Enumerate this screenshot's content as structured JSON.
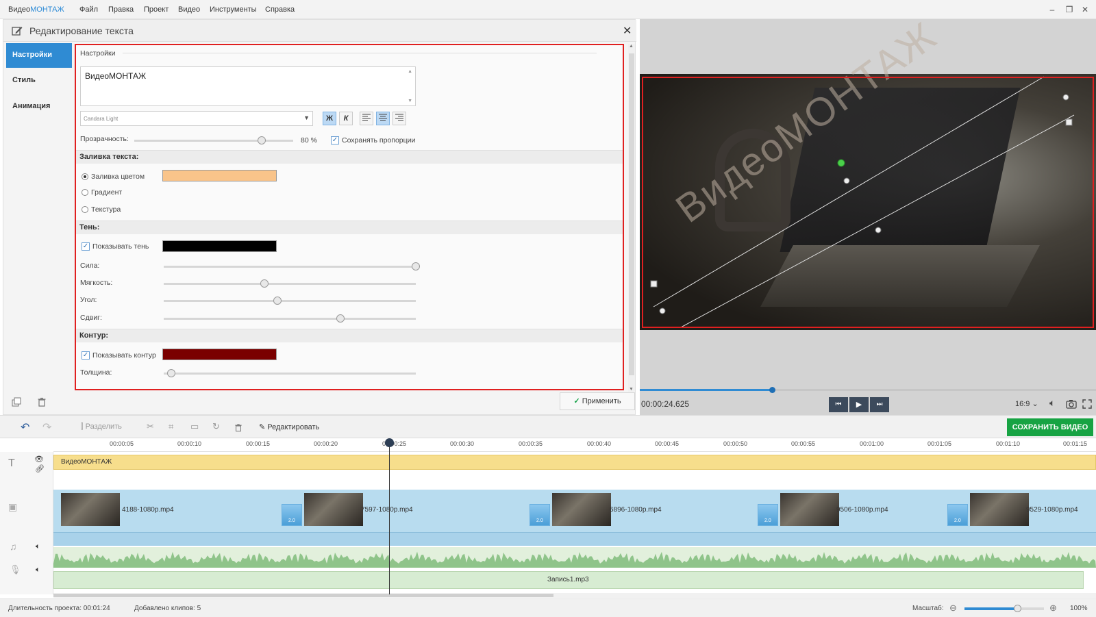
{
  "app": {
    "logo_main": "Видео",
    "logo_accent": "МОНТАЖ"
  },
  "menu": [
    "Файл",
    "Правка",
    "Проект",
    "Видео",
    "Инструменты",
    "Справка"
  ],
  "editor": {
    "title": "Редактирование текста",
    "tabs": [
      "Настройки",
      "Стиль",
      "Анимация"
    ],
    "settings_header": "Настройки",
    "text_value": "ВидеоМОНТАЖ",
    "font": "Candara Light",
    "bold_label": "Ж",
    "italic_label": "К",
    "opacity_label": "Прозрачность:",
    "opacity_value": "80 %",
    "opacity_fraction": 0.8,
    "keep_ratio_label": "Сохранять пропорции",
    "fill": {
      "header": "Заливка текста:",
      "options": [
        "Заливка цветом",
        "Градиент",
        "Текстура"
      ],
      "color": "#f9c48a"
    },
    "shadow": {
      "header": "Тень:",
      "show_label": "Показывать тень",
      "color": "#000000",
      "sliders": [
        {
          "label": "Сила:",
          "level": 1.0
        },
        {
          "label": "Мягкость:",
          "level": 0.4
        },
        {
          "label": "Угол:",
          "level": 0.45
        },
        {
          "label": "Сдвиг:",
          "level": 0.7
        }
      ]
    },
    "outline": {
      "header": "Контур:",
      "show_label": "Показывать контур",
      "color": "#7a0000",
      "thickness_label": "Толщина:",
      "thickness_level": 0.03
    },
    "apply_label": "Применить"
  },
  "preview": {
    "overlay_text": "ВидеоМОНТАЖ",
    "time": "00:00:24.625",
    "aspect": "16:9",
    "progress_fraction": 0.29
  },
  "toolbar": {
    "split": "Разделить",
    "edit": "Редактировать",
    "save_video": "СОХРАНИТЬ ВИДЕО"
  },
  "timeline": {
    "ticks": [
      "00:00:05",
      "00:00:10",
      "00:00:15",
      "00:00:20",
      "00:00:25",
      "00:00:30",
      "00:00:35",
      "00:00:40",
      "00:00:45",
      "00:00:50",
      "00:00:55",
      "00:01:00",
      "00:01:05",
      "00:01:10",
      "00:01:15"
    ],
    "text_track": "ВидеоМОНТАЖ",
    "clips": [
      "4188-1080p.mp4",
      "7597-1080p.mp4",
      "6896-1080p.mp4",
      "9506-1080p.mp4",
      "9529-1080p.mp4"
    ],
    "transition_label": "2.0",
    "voice_track": "Запись1.mp3"
  },
  "status": {
    "duration_label": "Длительность проекта:",
    "duration_value": "00:01:24",
    "clips_label": "Добавлено клипов:",
    "clips_value": "5",
    "zoom_label": "Масштаб:",
    "zoom_value": "100%"
  }
}
